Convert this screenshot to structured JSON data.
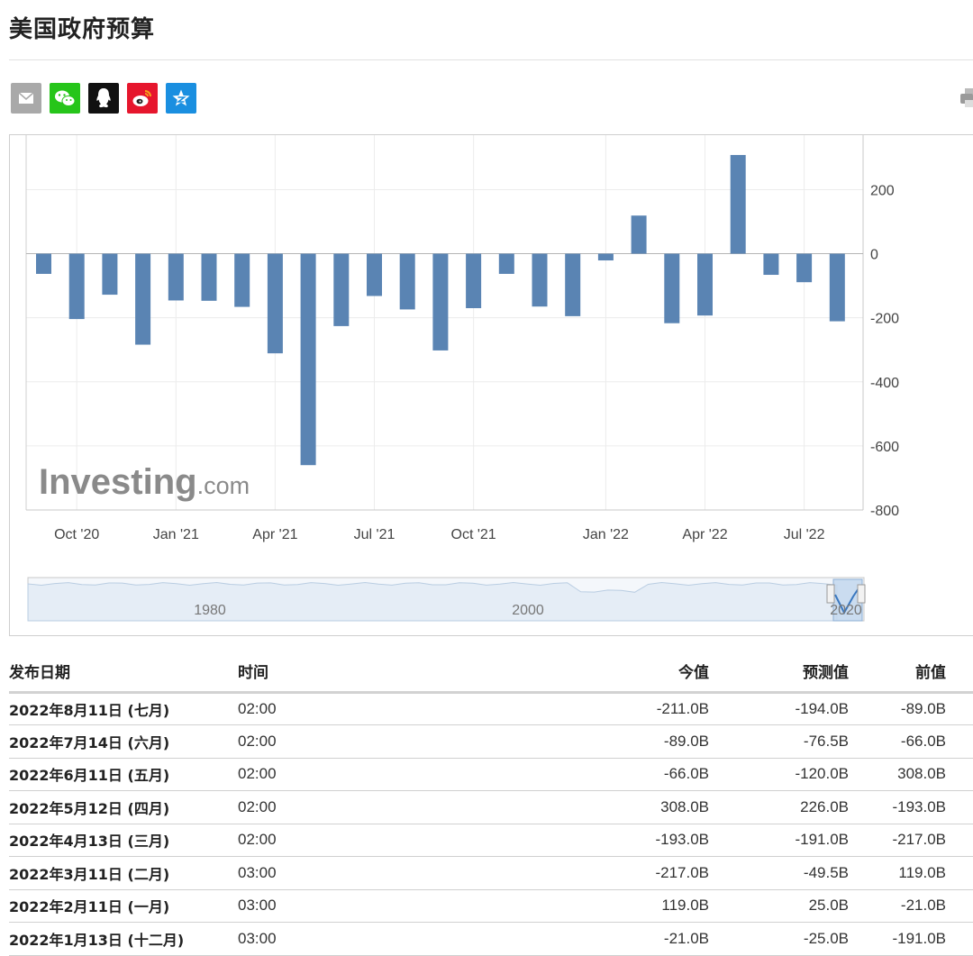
{
  "page": {
    "title": "美国政府预算"
  },
  "share": {
    "icons": [
      "mail-icon",
      "wechat-icon",
      "qq-icon",
      "weibo-icon",
      "qzone-icon"
    ],
    "print_icon": "print-icon"
  },
  "chart_data": {
    "type": "bar",
    "categories": [
      "Sep '20",
      "Oct '20",
      "Nov '20",
      "Dec '20",
      "Jan '21",
      "Feb '21",
      "Mar '21",
      "Apr '21",
      "May '21",
      "Jun '21",
      "Jul '21",
      "Aug '21",
      "Sep '21",
      "Oct '21",
      "Nov '21",
      "Dec '21",
      "Jan '22",
      "Feb '22",
      "Mar '22",
      "Apr '22",
      "May '22",
      "Jun '22",
      "Jul '22",
      "Aug '22"
    ],
    "values": [
      -63,
      -204,
      -128,
      -284,
      -146,
      -147,
      -166,
      -311,
      -660,
      -226,
      -132,
      -174,
      -302,
      -170,
      -63,
      -165,
      -195,
      -21,
      119,
      -217,
      -193,
      308,
      -66,
      -89,
      -211
    ],
    "x_tick_labels": [
      "Oct '20",
      "Jan '21",
      "Apr '21",
      "Jul '21",
      "Oct '21",
      "Jan '22",
      "Apr '22",
      "Jul '22"
    ],
    "y_tick_labels": [
      "200",
      "0",
      "-200",
      "-400",
      "-600",
      "-800"
    ],
    "ylim": [
      -800,
      370
    ],
    "bar_color": "#5a84b3",
    "grid": true,
    "y_axis_position": "right",
    "watermark": "Investing.com",
    "navigator": {
      "labels": [
        "1980",
        "2000",
        "2020"
      ]
    }
  },
  "table": {
    "headers": {
      "date": "发布日期",
      "time": "时间",
      "actual": "今值",
      "forecast": "预测值",
      "previous": "前值"
    },
    "rows": [
      {
        "date": "2022年8月11日 (七月)",
        "time": "02:00",
        "actual": "-211.0B",
        "actual_dir": "neg",
        "forecast": "-194.0B",
        "previous": "-89.0B"
      },
      {
        "date": "2022年7月14日 (六月)",
        "time": "02:00",
        "actual": "-89.0B",
        "actual_dir": "neg",
        "forecast": "-76.5B",
        "previous": "-66.0B"
      },
      {
        "date": "2022年6月11日 (五月)",
        "time": "02:00",
        "actual": "-66.0B",
        "actual_dir": "pos",
        "forecast": "-120.0B",
        "previous": "308.0B"
      },
      {
        "date": "2022年5月12日 (四月)",
        "time": "02:00",
        "actual": "308.0B",
        "actual_dir": "pos",
        "forecast": "226.0B",
        "previous": "-193.0B"
      },
      {
        "date": "2022年4月13日 (三月)",
        "time": "02:00",
        "actual": "-193.0B",
        "actual_dir": "neg",
        "forecast": "-191.0B",
        "previous": "-217.0B"
      },
      {
        "date": "2022年3月11日 (二月)",
        "time": "03:00",
        "actual": "-217.0B",
        "actual_dir": "neg",
        "forecast": "-49.5B",
        "previous": "119.0B"
      },
      {
        "date": "2022年2月11日 (一月)",
        "time": "03:00",
        "actual": "119.0B",
        "actual_dir": "pos",
        "forecast": "25.0B",
        "previous": "-21.0B"
      },
      {
        "date": "2022年1月13日 (十二月)",
        "time": "03:00",
        "actual": "-21.0B",
        "actual_dir": "pos",
        "forecast": "-25.0B",
        "previous": "-191.0B"
      }
    ]
  }
}
